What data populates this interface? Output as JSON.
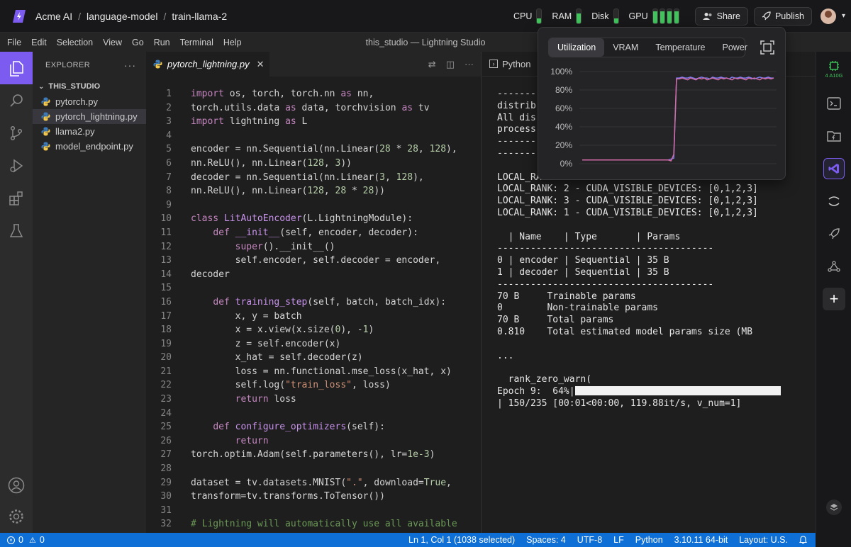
{
  "breadcrumb": {
    "org": "Acme AI",
    "project": "language-model",
    "studio": "train-llama-2"
  },
  "metrics": {
    "cpu_label": "CPU",
    "cpu_level": 0.35,
    "ram_label": "RAM",
    "ram_level": 0.7,
    "disk_label": "Disk",
    "disk_level": 0.35,
    "gpu_label": "GPU",
    "gpu_levels": [
      0.85,
      0.85,
      0.85,
      0.85
    ]
  },
  "top_actions": {
    "share_label": "Share",
    "publish_label": "Publish"
  },
  "menubar": {
    "items": [
      "File",
      "Edit",
      "Selection",
      "View",
      "Go",
      "Run",
      "Terminal",
      "Help"
    ],
    "window_title": "this_studio — Lightning Studio"
  },
  "explorer": {
    "title": "EXPLORER",
    "folder": "THIS_STUDIO",
    "files": [
      "pytorch.py",
      "pytorch_lightning.py",
      "llama2.py",
      "model_endpoint.py"
    ],
    "selected_index": 1
  },
  "editor": {
    "tab_label": "pytorch_lightning.py",
    "lines": [
      [
        [
          "kw",
          "import"
        ],
        [
          "t",
          " os, torch, torch.nn "
        ],
        [
          "kw",
          "as"
        ],
        [
          "t",
          " nn,"
        ]
      ],
      [
        [
          "t",
          "torch.utils.data "
        ],
        [
          "kw",
          "as"
        ],
        [
          "t",
          " data, torchvision "
        ],
        [
          "kw",
          "as"
        ],
        [
          "t",
          " tv"
        ]
      ],
      [
        [
          "kw",
          "import"
        ],
        [
          "t",
          " lightning "
        ],
        [
          "kw",
          "as"
        ],
        [
          "t",
          " L"
        ]
      ],
      [],
      [
        [
          "t",
          "encoder = nn.Sequential(nn.Linear("
        ],
        [
          "num",
          "28"
        ],
        [
          "t",
          " * "
        ],
        [
          "num",
          "28"
        ],
        [
          "t",
          ", "
        ],
        [
          "num",
          "128"
        ],
        [
          "t",
          "),"
        ]
      ],
      [
        [
          "t",
          "nn.ReLU(), nn.Linear("
        ],
        [
          "num",
          "128"
        ],
        [
          "t",
          ", "
        ],
        [
          "num",
          "3"
        ],
        [
          "t",
          "))"
        ]
      ],
      [
        [
          "t",
          "decoder = nn.Sequential(nn.Linear("
        ],
        [
          "num",
          "3"
        ],
        [
          "t",
          ", "
        ],
        [
          "num",
          "128"
        ],
        [
          "t",
          "),"
        ]
      ],
      [
        [
          "t",
          "nn.ReLU(), nn.Linear("
        ],
        [
          "num",
          "128"
        ],
        [
          "t",
          ", "
        ],
        [
          "num",
          "28"
        ],
        [
          "t",
          " * "
        ],
        [
          "num",
          "28"
        ],
        [
          "t",
          "))"
        ]
      ],
      [],
      [
        [
          "kw",
          "class"
        ],
        [
          "t",
          " "
        ],
        [
          "fn",
          "LitAutoEncoder"
        ],
        [
          "t",
          "(L.LightningModule):"
        ]
      ],
      [
        [
          "t",
          "    "
        ],
        [
          "kw",
          "def"
        ],
        [
          "t",
          " "
        ],
        [
          "fn",
          "__init__"
        ],
        [
          "t",
          "(self, encoder, decoder):"
        ]
      ],
      [
        [
          "t",
          "        "
        ],
        [
          "bi",
          "super"
        ],
        [
          "t",
          "().__init__()"
        ]
      ],
      [
        [
          "t",
          "        self.encoder, self.decoder = encoder,"
        ]
      ],
      [
        [
          "t",
          "decoder"
        ]
      ],
      [],
      [
        [
          "t",
          "    "
        ],
        [
          "kw",
          "def"
        ],
        [
          "t",
          " "
        ],
        [
          "fn",
          "training_step"
        ],
        [
          "t",
          "(self, batch, batch_idx):"
        ]
      ],
      [
        [
          "t",
          "        x, y = batch"
        ]
      ],
      [
        [
          "t",
          "        x = x.view(x.size("
        ],
        [
          "num",
          "0"
        ],
        [
          "t",
          "), -"
        ],
        [
          "num",
          "1"
        ],
        [
          "t",
          ")"
        ]
      ],
      [
        [
          "t",
          "        z = self.encoder(x)"
        ]
      ],
      [
        [
          "t",
          "        x_hat = self.decoder(z)"
        ]
      ],
      [
        [
          "t",
          "        loss = nn.functional.mse_loss(x_hat, x)"
        ]
      ],
      [
        [
          "t",
          "        self.log("
        ],
        [
          "str",
          "\"train_loss\""
        ],
        [
          "t",
          ", loss)"
        ]
      ],
      [
        [
          "t",
          "        "
        ],
        [
          "kw",
          "return"
        ],
        [
          "t",
          " loss"
        ]
      ],
      [],
      [
        [
          "t",
          "    "
        ],
        [
          "kw",
          "def"
        ],
        [
          "t",
          " "
        ],
        [
          "fn",
          "configure_optimizers"
        ],
        [
          "t",
          "(self):"
        ]
      ],
      [
        [
          "t",
          "        "
        ],
        [
          "kw",
          "return"
        ]
      ],
      [
        [
          "t",
          "torch.optim.Adam(self.parameters(), lr="
        ],
        [
          "num",
          "1e-3"
        ],
        [
          "t",
          ")"
        ]
      ],
      [],
      [
        [
          "t",
          "dataset = tv.datasets.MNIST("
        ],
        [
          "str",
          "\".\""
        ],
        [
          "t",
          ", download="
        ],
        [
          "num",
          "True"
        ],
        [
          "t",
          ","
        ]
      ],
      [
        [
          "t",
          "transform=tv.transforms.ToTensor())"
        ]
      ],
      [],
      [
        [
          "cm",
          "# Lightning will automatically use all available"
        ]
      ]
    ]
  },
  "panel": {
    "tab_label": "Python",
    "terminal_lines": [
      "--------",
      "distrib",
      "All dis                                         4",
      "process",
      "----------------------------------------------------",
      "--------",
      "",
      "LOCAL_RA",
      "LOCAL_RANK: 2 - CUDA_VISIBLE_DEVICES: [0,1,2,3]",
      "LOCAL_RANK: 3 - CUDA_VISIBLE_DEVICES: [0,1,2,3]",
      "LOCAL_RANK: 1 - CUDA_VISIBLE_DEVICES: [0,1,2,3]",
      "",
      "  | Name    | Type       | Params",
      "---------------------------------------",
      "0 | encoder | Sequential | 35 B",
      "1 | decoder | Sequential | 35 B",
      "---------------------------------------",
      "70 B     Trainable params",
      "0        Non-trainable params",
      "70 B     Total params",
      "0.810    Total estimated model params size (MB",
      "",
      "...",
      "",
      "  rank_zero_warn(",
      "Epoch 9:  64%|",
      "| 150/235 [00:01<00:00, 119.88it/s, v_num=1]"
    ],
    "progress_value": 0.64
  },
  "popover": {
    "tabs": [
      "Utilization",
      "VRAM",
      "Temperature",
      "Power"
    ],
    "active_tab": 0,
    "y_ticks": [
      "100%",
      "80%",
      "60%",
      "40%",
      "20%",
      "0%"
    ]
  },
  "chart_data": {
    "type": "line",
    "ylim": [
      0,
      100
    ],
    "yticks": [
      "0%",
      "20%",
      "40%",
      "60%",
      "80%",
      "100%"
    ],
    "grid": true,
    "series": [
      {
        "color": "#7c7cf0",
        "values": [
          4,
          4,
          4,
          4,
          4,
          4,
          4,
          4,
          4,
          4,
          4,
          4,
          4,
          4,
          4,
          4,
          4,
          4,
          4,
          4,
          4,
          4,
          4,
          4,
          4,
          4,
          4,
          4,
          4,
          4,
          4,
          4,
          5,
          6,
          93,
          93,
          94,
          93,
          93,
          94,
          93,
          92,
          93,
          94,
          93,
          93,
          92,
          94,
          93,
          93,
          94,
          93,
          93,
          92,
          94,
          93,
          93,
          94,
          93,
          93,
          94,
          93,
          92,
          93,
          94,
          93,
          93,
          94,
          93,
          93
        ]
      },
      {
        "color": "#d16ba5",
        "values": [
          4,
          4,
          4,
          4,
          4,
          4,
          4,
          4,
          4,
          4,
          4,
          4,
          4,
          4,
          4,
          4,
          4,
          4,
          4,
          4,
          4,
          4,
          4,
          4,
          4,
          4,
          4,
          4,
          4,
          4,
          4,
          4,
          3,
          10,
          92,
          92,
          93,
          92,
          91,
          93,
          92,
          91,
          93,
          92,
          93,
          91,
          92,
          93,
          92,
          91,
          93,
          92,
          93,
          92,
          91,
          93,
          92,
          93,
          92,
          91,
          93,
          92,
          93,
          92,
          91,
          93,
          92,
          93,
          92,
          93
        ]
      }
    ]
  },
  "status": {
    "errors": "0",
    "warnings": "0",
    "cursor": "Ln 1, Col 1 (1038 selected)",
    "spaces": "Spaces: 4",
    "encoding": "UTF-8",
    "eol": "LF",
    "language": "Python",
    "interpreter": "3.10.11 64-bit",
    "layout": "Layout: U.S."
  },
  "rail": {
    "gpu_badge": "4 A10G"
  },
  "colors": {
    "accent": "#7c5cf0",
    "status_bar": "#0e6fd6",
    "meter_green": "#3fc55b"
  }
}
